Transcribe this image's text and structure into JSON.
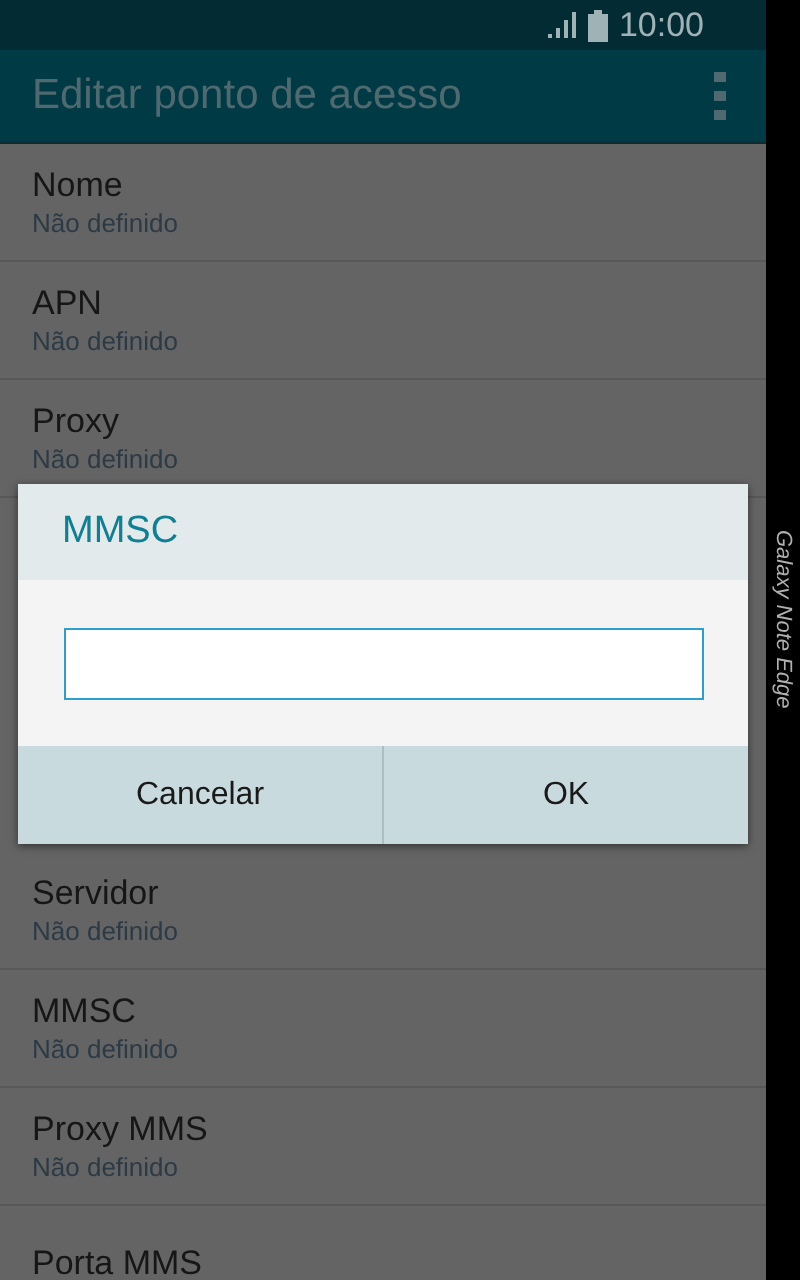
{
  "status_bar": {
    "time": "10:00"
  },
  "toolbar": {
    "title": "Editar ponto de acesso"
  },
  "settings_top": [
    {
      "title": "Nome",
      "subtitle": "Não definido"
    },
    {
      "title": "APN",
      "subtitle": "Não definido"
    },
    {
      "title": "Proxy",
      "subtitle": "Não definido"
    }
  ],
  "settings_bottom": [
    {
      "title": "Servidor",
      "subtitle": "Não definido"
    },
    {
      "title": "MMSC",
      "subtitle": "Não definido"
    },
    {
      "title": "Proxy MMS",
      "subtitle": "Não definido"
    },
    {
      "title": "Porta MMS"
    }
  ],
  "dialog": {
    "title": "MMSC",
    "buttons": [
      "Cancelar",
      "OK"
    ]
  },
  "edge_panel": {
    "text": "Galaxy Note Edge"
  }
}
